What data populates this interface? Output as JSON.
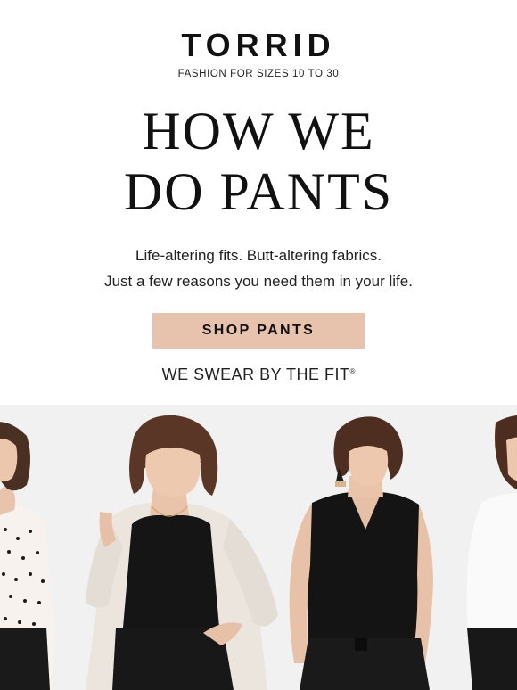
{
  "brand": {
    "logo_text": "TORRID",
    "tagline": "FASHION FOR SIZES 10 TO 30"
  },
  "headline": {
    "line1": "HOW WE",
    "line2": "DO PANTS"
  },
  "subtext": {
    "line1": "Life-altering fits. Butt-altering fabrics.",
    "line2": "Just a few reasons you need them in your life."
  },
  "cta": {
    "label": "SHOP PANTS"
  },
  "tagline2": {
    "text": "WE SWEAR BY THE FIT",
    "mark": "®"
  },
  "colors": {
    "cta_background": "#e7c2ac",
    "text": "#111111",
    "hero_background": "#f1f1f1"
  }
}
